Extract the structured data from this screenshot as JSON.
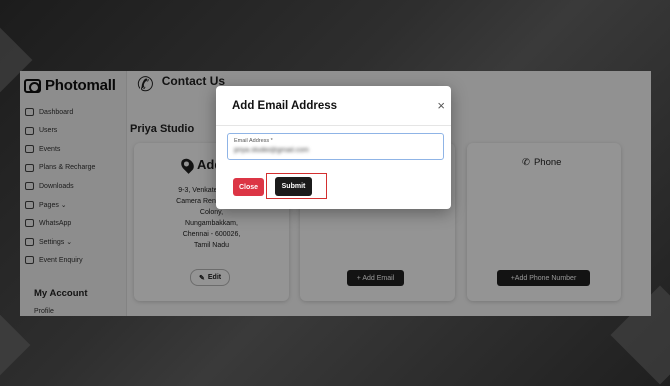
{
  "app": {
    "logo_text": "Photomall"
  },
  "sidebar": {
    "items": [
      {
        "label": "Dashboard",
        "icon": "dashboard-icon"
      },
      {
        "label": "Users",
        "icon": "users-icon"
      },
      {
        "label": "Events",
        "icon": "events-icon"
      },
      {
        "label": "Plans & Recharge",
        "icon": "plans-icon"
      },
      {
        "label": "Downloads",
        "icon": "download-icon"
      },
      {
        "label": "Pages ⌄",
        "icon": "pages-icon"
      },
      {
        "label": "WhatsApp",
        "icon": "whatsapp-icon"
      },
      {
        "label": "Settings ⌄",
        "icon": "gear-icon"
      },
      {
        "label": "Event Enquiry",
        "icon": "enquiry-icon"
      }
    ],
    "account_heading": "My Account",
    "profile_label": "Profile"
  },
  "main": {
    "contact_title": "Contact Us",
    "studio_name": "Priya Studio",
    "address_card": {
      "title": "Addr",
      "lines": [
        "9-3, Venkateswara St",
        "Camera Rent, Thangal",
        "Colony,",
        "Nungambakkam,",
        "Chennai - 600026,",
        "Tamil Nadu"
      ],
      "edit_label": "Edit"
    },
    "email_card": {
      "button_label": "+ Add Email"
    },
    "phone_card": {
      "title": "Phone",
      "button_label": "+Add Phone Number"
    }
  },
  "modal": {
    "title": "Add Email Address",
    "close_symbol": "×",
    "field_label": "Email Address *",
    "field_value": "priya.studio@gmail.com",
    "close_button": "Close",
    "submit_button": "Submit"
  },
  "colors": {
    "danger": "#dc3545",
    "dark": "#1b1b1b",
    "focus": "#8fb4e6",
    "highlight": "#d32f2f"
  }
}
